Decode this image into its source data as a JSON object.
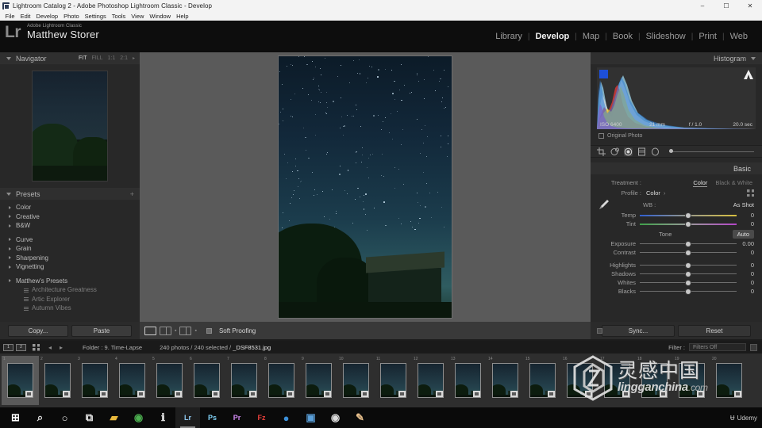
{
  "window": {
    "title": "Lightroom Catalog 2 - Adobe Photoshop Lightroom Classic - Develop",
    "app_icon": "lightroom-icon",
    "minimize": "–",
    "maximize": "☐",
    "close": "✕"
  },
  "menubar": [
    "File",
    "Edit",
    "Develop",
    "Photo",
    "Settings",
    "Tools",
    "View",
    "Window",
    "Help"
  ],
  "identity": {
    "logo": "Lr",
    "product": "Adobe Lightroom Classic",
    "user": "Matthew Storer"
  },
  "modules": [
    {
      "label": "Library",
      "active": false
    },
    {
      "label": "Develop",
      "active": true
    },
    {
      "label": "Map",
      "active": false
    },
    {
      "label": "Book",
      "active": false
    },
    {
      "label": "Slideshow",
      "active": false
    },
    {
      "label": "Print",
      "active": false
    },
    {
      "label": "Web",
      "active": false
    }
  ],
  "navigator": {
    "title": "Navigator",
    "zooms": [
      {
        "label": "FIT",
        "active": true
      },
      {
        "label": "FILL",
        "active": false
      },
      {
        "label": "1:1",
        "active": false
      },
      {
        "label": "2:1",
        "active": false
      }
    ],
    "chevron": "▸"
  },
  "presets": {
    "title": "Presets",
    "add": "+",
    "groups": [
      {
        "items": [
          "Color",
          "Creative",
          "B&W"
        ]
      },
      {
        "items": [
          "Curve",
          "Grain",
          "Sharpening",
          "Vignetting"
        ]
      }
    ],
    "user_group": "Matthew's Presets",
    "user_items": [
      "Architecture Greatness",
      "Artic Explorer",
      "Autumn Vibes"
    ]
  },
  "histogram": {
    "title": "Histogram",
    "iso": "ISO 6400",
    "focal": "21 mm",
    "aperture": "f / 1.0",
    "shutter": "20.0 sec",
    "original_photo": "Original Photo"
  },
  "tools": [
    {
      "name": "crop-tool",
      "selected": false
    },
    {
      "name": "spot-removal-tool",
      "selected": false
    },
    {
      "name": "red-eye-tool",
      "selected": true
    },
    {
      "name": "graduated-filter-tool",
      "selected": false
    },
    {
      "name": "radial-filter-tool",
      "selected": false
    }
  ],
  "basic": {
    "title": "Basic",
    "treatment_label": "Treatment :",
    "treatment_options": [
      {
        "label": "Color",
        "active": true
      },
      {
        "label": "Black & White",
        "active": false
      }
    ],
    "profile_label": "Profile :",
    "profile_value": "Color",
    "profile_chevron": "›",
    "wb_label": "WB :",
    "wb_value": "As Shot",
    "wb_chevron": "›",
    "wb_sliders": [
      {
        "label": "Temp",
        "value": "0",
        "pos": 50,
        "kind": "temp"
      },
      {
        "label": "Tint",
        "value": "0",
        "pos": 50,
        "kind": "tint"
      }
    ],
    "tone_label": "Tone",
    "auto_label": "Auto",
    "tone_sliders": [
      {
        "label": "Exposure",
        "value": "0.00",
        "pos": 50
      },
      {
        "label": "Contrast",
        "value": "0",
        "pos": 50
      }
    ],
    "detail_sliders": [
      {
        "label": "Highlights",
        "value": "0",
        "pos": 50
      },
      {
        "label": "Shadows",
        "value": "0",
        "pos": 50
      },
      {
        "label": "Whites",
        "value": "0",
        "pos": 50
      },
      {
        "label": "Blacks",
        "value": "0",
        "pos": 50
      }
    ]
  },
  "left_tools": {
    "copy": "Copy...",
    "paste": "Paste"
  },
  "center_tools": {
    "soft_proofing": "Soft Proofing",
    "view_single": "loupe-view-icon",
    "view_before_after": "before-after-view-icon",
    "dot1": "▪",
    "dot2": "▪"
  },
  "right_tools": {
    "sync": "Sync...",
    "reset": "Reset"
  },
  "filmstrip_bar": {
    "grid_view": "1",
    "second_view": "2",
    "back_arrow": "◂",
    "forward_arrow": "▸",
    "folder": "Folder : 9. Time-Lapse",
    "count": "240 photos / 240 selected / ",
    "filename": "_DSF8531.jpg",
    "filter_label": "Filter :",
    "filter_value": "Filters Off"
  },
  "filmstrip": {
    "thumbnails": [
      {
        "num": "1",
        "selected": true
      },
      {
        "num": "2",
        "selected": false
      },
      {
        "num": "3",
        "selected": false
      },
      {
        "num": "4",
        "selected": false
      },
      {
        "num": "5",
        "selected": false
      },
      {
        "num": "6",
        "selected": false
      },
      {
        "num": "7",
        "selected": false
      },
      {
        "num": "8",
        "selected": false
      },
      {
        "num": "9",
        "selected": false
      },
      {
        "num": "10",
        "selected": false
      },
      {
        "num": "11",
        "selected": false
      },
      {
        "num": "12",
        "selected": false
      },
      {
        "num": "13",
        "selected": false
      },
      {
        "num": "14",
        "selected": false
      },
      {
        "num": "15",
        "selected": false
      },
      {
        "num": "16",
        "selected": false
      },
      {
        "num": "17",
        "selected": false
      },
      {
        "num": "18",
        "selected": false
      },
      {
        "num": "19",
        "selected": false
      },
      {
        "num": "20",
        "selected": false
      }
    ]
  },
  "taskbar": {
    "items": [
      {
        "name": "start-button",
        "glyph": "⊞",
        "color": "#ffffff",
        "active": false
      },
      {
        "name": "search-icon",
        "glyph": "⌕",
        "color": "#e8e8e8",
        "active": false
      },
      {
        "name": "cortana-icon",
        "glyph": "○",
        "color": "#e8e8e8",
        "active": false
      },
      {
        "name": "task-view-icon",
        "glyph": "⧉",
        "color": "#e8e8e8",
        "active": false
      },
      {
        "name": "file-explorer-icon",
        "glyph": "▰",
        "color": "#e8b83c",
        "active": false
      },
      {
        "name": "chrome-icon",
        "glyph": "◉",
        "color": "#4caf50",
        "active": false
      },
      {
        "name": "info-app-icon",
        "glyph": "ℹ",
        "color": "#dcdcdc",
        "active": false
      },
      {
        "name": "lightroom-icon",
        "glyph": "Lr",
        "color": "#8fc8f0",
        "active": true
      },
      {
        "name": "photoshop-icon",
        "glyph": "Ps",
        "color": "#7fd0f5",
        "active": false
      },
      {
        "name": "premiere-icon",
        "glyph": "Pr",
        "color": "#d58cf5",
        "active": false
      },
      {
        "name": "filezilla-icon",
        "glyph": "Fz",
        "color": "#e8403c",
        "active": false
      },
      {
        "name": "browser-icon",
        "glyph": "●",
        "color": "#3b8fd8",
        "active": false
      },
      {
        "name": "gallery-icon",
        "glyph": "▣",
        "color": "#5a9fd8",
        "active": false
      },
      {
        "name": "disc-icon",
        "glyph": "◉",
        "color": "#dcdcdc",
        "active": false
      },
      {
        "name": "paint-icon",
        "glyph": "✎",
        "color": "#e8c08c",
        "active": false
      }
    ],
    "udemy_label": "Udemy",
    "udemy_mark": "Ʉ"
  },
  "watermark": {
    "chinese": "灵感中国",
    "url_main": "lingganchina",
    "url_tld": ".com"
  }
}
